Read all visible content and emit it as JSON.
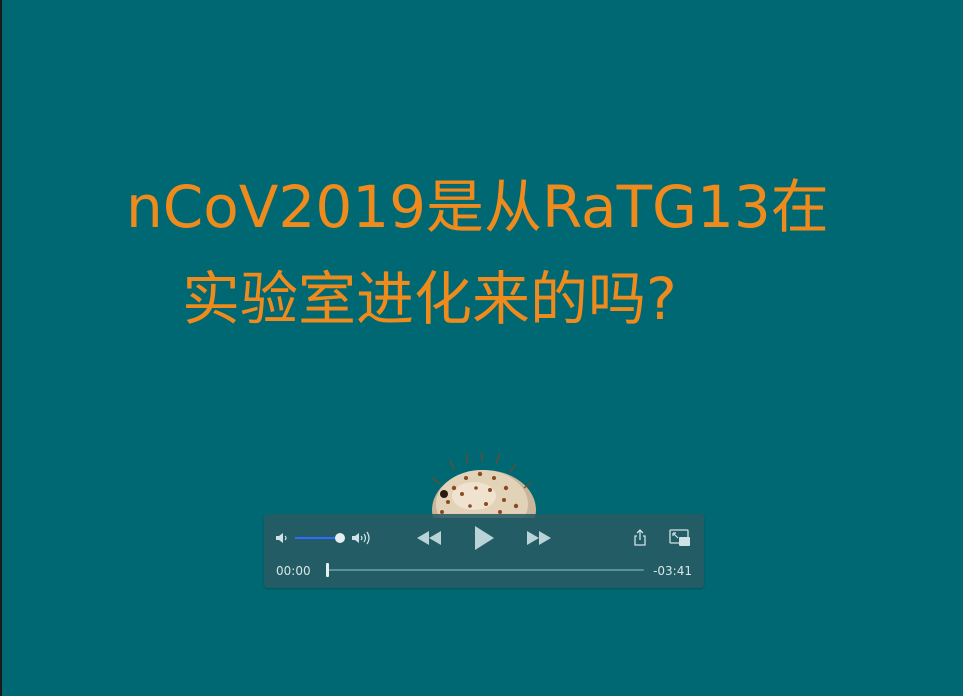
{
  "slide": {
    "title_line_1": "nCoV2019是从RaTG13在",
    "title_line_2": "实验室进化来的吗?"
  },
  "colors": {
    "background": "#006872",
    "title_text": "#ef8a1d",
    "control_bar": "#285a62",
    "volume_fill": "#2f6bff"
  },
  "player": {
    "elapsed": "00:00",
    "remaining": "-03:41",
    "volume_level": 0.9,
    "progress": 0.0,
    "icons": [
      "volume-low-icon",
      "volume-high-icon",
      "rewind-icon",
      "play-icon",
      "fast-forward-icon",
      "share-icon",
      "picture-in-picture-icon"
    ]
  },
  "artwork": {
    "icon": "pufferfish-icon"
  }
}
